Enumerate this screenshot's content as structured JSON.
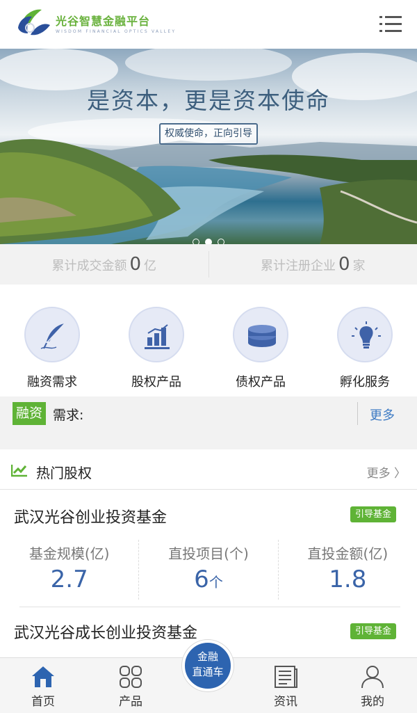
{
  "header": {
    "brand_cn": "光谷智慧金融平台",
    "brand_en": "WISDOM FINANCIAL OPTICS VALLEY",
    "menu_icon": "hamburger-menu-icon"
  },
  "banner": {
    "slogan": "是资本，更是资本使命",
    "tag": "权威使命，正向引导",
    "slides": 3,
    "active_slide": 2
  },
  "stats": {
    "deal_prefix": "累计成交金额",
    "deal_value": "0",
    "deal_unit": "亿",
    "reg_prefix": "累计注册企业",
    "reg_value": "0",
    "reg_unit": "家"
  },
  "quicknav": [
    {
      "label": "融资需求",
      "icon": "feather-pen-icon"
    },
    {
      "label": "股权产品",
      "icon": "bar-chart-icon"
    },
    {
      "label": "债权产品",
      "icon": "coin-stack-icon"
    },
    {
      "label": "孵化服务",
      "icon": "lightbulb-icon"
    }
  ],
  "financing": {
    "tag": "融资",
    "text": "需求:",
    "more": "更多"
  },
  "hot": {
    "title": "热门股权",
    "more": "更多 〉",
    "funds": [
      {
        "name": "武汉光谷创业投资基金",
        "badge": "引导基金",
        "metrics": [
          {
            "label": "基金规模(亿)",
            "value": "2.7",
            "unit": ""
          },
          {
            "label": "直投项目(个)",
            "value": "6",
            "unit": "个"
          },
          {
            "label": "直投金额(亿)",
            "value": "1.8",
            "unit": ""
          }
        ]
      },
      {
        "name": "武汉光谷成长创业投资基金",
        "badge": "引导基金"
      }
    ]
  },
  "bottomnav": {
    "home": "首页",
    "products": "产品",
    "center_line1": "金融",
    "center_line2": "直通车",
    "news": "资讯",
    "mine": "我的"
  },
  "colors": {
    "brand_green": "#5fb336",
    "brand_blue": "#2d64b0",
    "link_blue": "#3c7ac4",
    "metric_blue": "#3a64a8"
  }
}
